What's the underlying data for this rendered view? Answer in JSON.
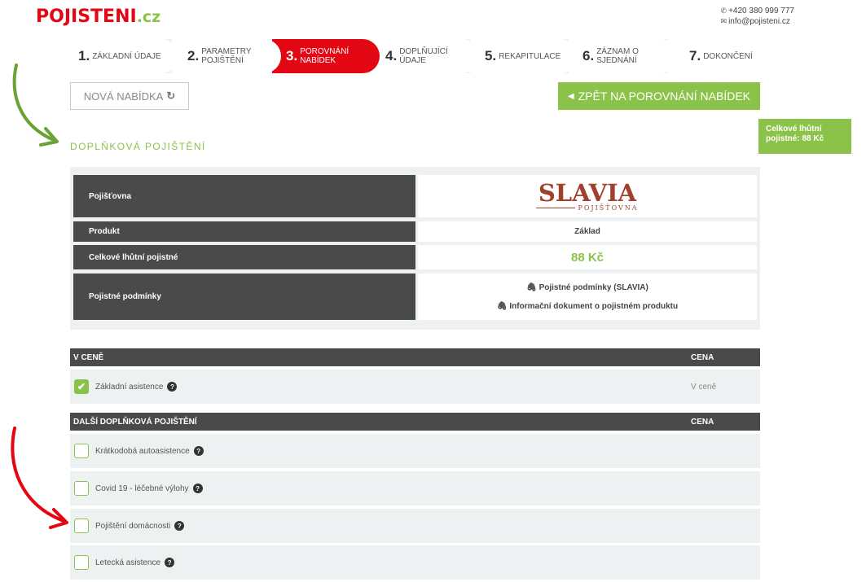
{
  "header": {
    "logo_main": "POJISTENI",
    "logo_tld": ".cz",
    "phone": "+420 380 999 777",
    "email": "info@pojisteni.cz"
  },
  "steps": [
    {
      "num": "1.",
      "label": "ZÁKLADNÍ ÚDAJE"
    },
    {
      "num": "2.",
      "label": "PARAMETRY POJIŠTĚNÍ"
    },
    {
      "num": "3.",
      "label": "POROVNÁNÍ NABÍDEK"
    },
    {
      "num": "4.",
      "label": "DOPLŇUJÍCÍ ÚDAJE"
    },
    {
      "num": "5.",
      "label": "REKAPITULACE"
    },
    {
      "num": "6.",
      "label": "ZÁZNAM O SJEDNÁNÍ"
    },
    {
      "num": "7.",
      "label": "DOKONČENÍ"
    }
  ],
  "active_step": 3,
  "buttons": {
    "new_offer": "NOVÁ NABÍDKA",
    "back": "ZPĚT NA POROVNÁNÍ NABÍDEK"
  },
  "total_box": {
    "line1": "Celkové lhůtní",
    "line2": "pojistné:  88 Kč"
  },
  "section_title": "DOPLŇKOVÁ POJIŠTĚNÍ",
  "info": {
    "insurer_label": "Pojišťovna",
    "insurer_logo_main": "SLAVIA",
    "insurer_logo_sub": "POJIŠŤOVNA",
    "product_label": "Produkt",
    "product_value": "Základ",
    "total_label": "Celkové lhůtní pojistné",
    "total_value": "88 Kč",
    "conditions_label": "Pojistné podmínky",
    "conditions_link1": "Pojistné podmínky (SLAVIA)",
    "conditions_link2": "Informační dokument o pojistném produktu"
  },
  "included": {
    "header": "V CENĚ",
    "price_header": "CENA",
    "items": [
      {
        "name": "Základní asistence",
        "price": "V ceně",
        "checked": true
      }
    ]
  },
  "additional": {
    "header": "DALŠÍ DOPLŇKOVÁ POJIŠTĚNÍ",
    "price_header": "CENA",
    "items": [
      {
        "name": "Krátkodobá autoasistence",
        "checked": false
      },
      {
        "name": "Covid 19 - léčebné výlohy",
        "checked": false
      },
      {
        "name": "Pojištění domácnosti",
        "checked": false
      },
      {
        "name": "Letecká asistence",
        "checked": false
      }
    ]
  },
  "colors": {
    "brand_red": "#e30613",
    "brand_green": "#8bc34a",
    "dark_header": "#4a4a4a",
    "row_bg": "#eef1f2",
    "slavia": "#a0412d"
  }
}
